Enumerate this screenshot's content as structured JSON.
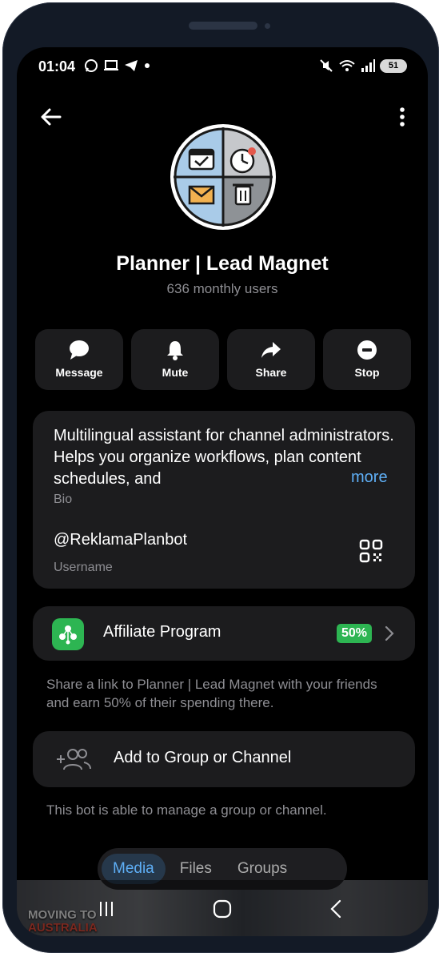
{
  "status_bar": {
    "time": "01:04",
    "battery": "51"
  },
  "profile": {
    "name": "Planner | Lead Magnet",
    "subtitle": "636 monthly users"
  },
  "actions": [
    {
      "label": "Message",
      "icon": "message-icon"
    },
    {
      "label": "Mute",
      "icon": "bell-icon"
    },
    {
      "label": "Share",
      "icon": "share-icon"
    },
    {
      "label": "Stop",
      "icon": "stop-icon"
    }
  ],
  "bio": {
    "text": "Multilingual assistant for channel administrators. Helps you organize workflows, plan content schedules, and",
    "more": "more",
    "label": "Bio"
  },
  "username": {
    "value": "@ReklamaPlanbot",
    "label": "Username"
  },
  "affiliate": {
    "label": "Affiliate Program",
    "badge": "50%",
    "description": "Share a link to Planner | Lead Magnet with your friends and earn 50% of their spending there."
  },
  "add_group": {
    "label": "Add to Group or Channel",
    "description": "This bot is able to manage a group or channel."
  },
  "tabs": [
    "Media",
    "Files",
    "Groups"
  ],
  "active_tab": "Media",
  "media_thumb": {
    "line1": "MOVING TO",
    "line2": "AUSTRALIA"
  },
  "colors": {
    "accent": "#5eaef5",
    "badge_green": "#2db552",
    "card_bg": "#1c1c1e",
    "muted_text": "#8e8e93"
  }
}
